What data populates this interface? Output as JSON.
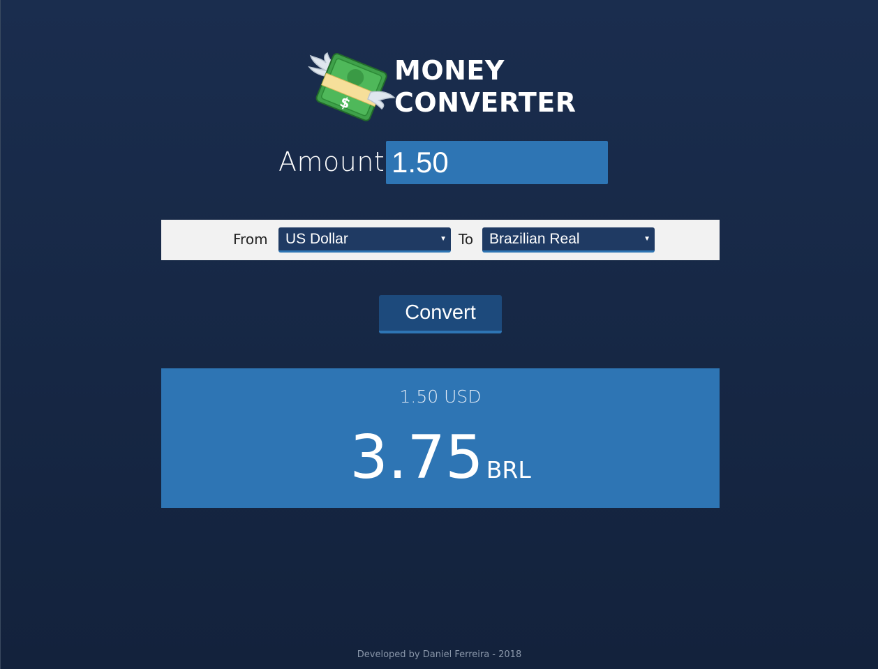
{
  "header": {
    "logo_icon": "flying-money-icon",
    "title_line1": "MONEY",
    "title_line2": "CONVERTER"
  },
  "amount": {
    "label": "Amount",
    "value": "1.50"
  },
  "currency": {
    "from_label": "From",
    "from_selected": "US Dollar",
    "to_label": "To",
    "to_selected": "Brazilian Real"
  },
  "convert_button": {
    "label": "Convert"
  },
  "result": {
    "source": "1.50 USD",
    "value": "3.75",
    "code": "BRL"
  },
  "footer": {
    "text": "Developed by Daniel Ferreira - 2018"
  },
  "colors": {
    "background": "#1a2d4e",
    "accent": "#2e75b4",
    "select_bg": "#1f3a63",
    "bar_bg": "#f2f2f2"
  }
}
